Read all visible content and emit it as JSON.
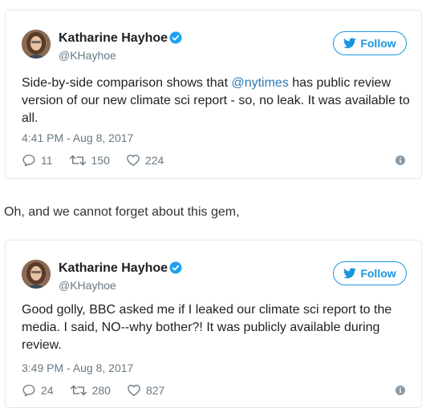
{
  "tweets": [
    {
      "author": {
        "name": "Katharine Hayhoe",
        "handle": "@KHayhoe",
        "avatar": "avatar-photo",
        "verified_icon": "verified-badge-icon"
      },
      "follow_label": "Follow",
      "text_before": "Side-by-side comparison shows that ",
      "mention": "@nytimes",
      "text_after": " has public review version of our new climate sci report - so, no leak. It was available to all.",
      "timestamp": "4:41 PM - Aug 8, 2017",
      "stats": {
        "replies": "11",
        "retweets": "150",
        "likes": "224"
      }
    },
    {
      "author": {
        "name": "Katharine Hayhoe",
        "handle": "@KHayhoe",
        "avatar": "avatar-photo",
        "verified_icon": "verified-badge-icon"
      },
      "follow_label": "Follow",
      "text": "Good golly, BBC asked me if I leaked our climate sci report to the media. I said, NO--why bother?! It was publicly available during review.",
      "timestamp": "3:49 PM - Aug 8, 2017",
      "stats": {
        "replies": "24",
        "retweets": "280",
        "likes": "827"
      }
    }
  ],
  "between_text": "Oh, and we cannot forget about this gem,",
  "colors": {
    "link_blue": "#1b95e0",
    "mention_blue": "#2b7bb9",
    "meta_gray": "#697882",
    "border": "#e1e8ed"
  }
}
